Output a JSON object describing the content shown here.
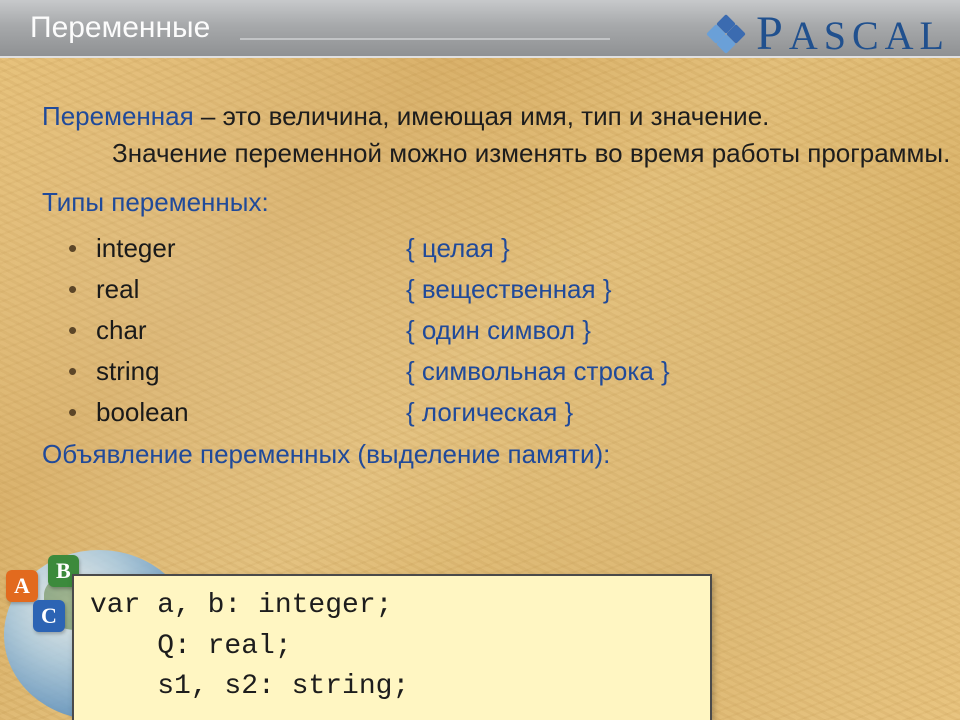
{
  "header": {
    "title": "Переменные"
  },
  "brand": {
    "text": "PASCAL",
    "first": "P",
    "rest": "ASCAL"
  },
  "definition": {
    "term": "Переменная",
    "dash": " – это величина, имеющая имя, тип и значение.",
    "rest": "Значение переменной можно изменять во время работы программы."
  },
  "types_heading": "Типы переменных:",
  "types": [
    {
      "name": "integer",
      "desc": "{ целая }"
    },
    {
      "name": "real",
      "desc": "{ вещественная }"
    },
    {
      "name": "char",
      "desc": "{ один символ }"
    },
    {
      "name": "string",
      "desc": "{ символьная строка }"
    },
    {
      "name": "boolean",
      "desc": "{ логическая }"
    }
  ],
  "declaration_heading": "Объявление переменных (выделение памяти):",
  "code": {
    "l1": "var a, b: integer;",
    "l2": "    Q: real;",
    "l3": "    s1, s2: string;"
  },
  "tags": {
    "A": "A",
    "B": "B",
    "C": "C"
  }
}
